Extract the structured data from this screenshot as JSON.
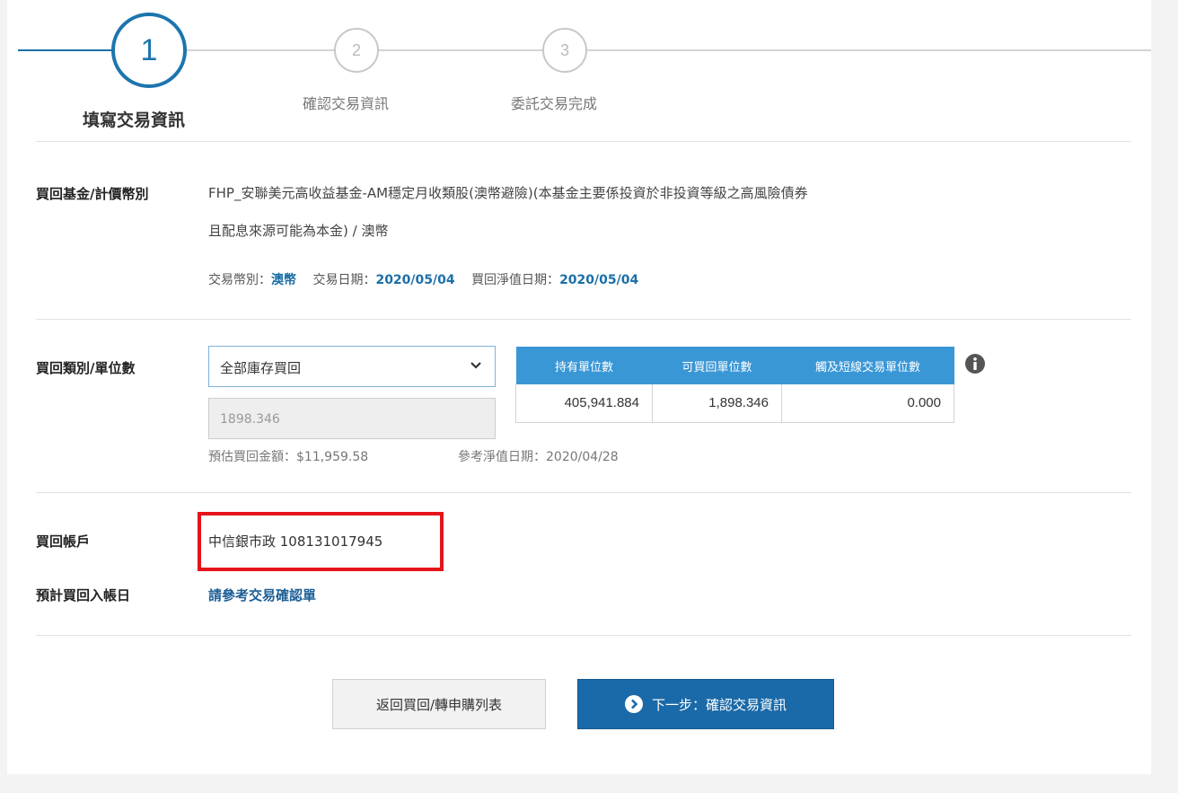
{
  "stepper": {
    "steps": [
      {
        "number": "1",
        "label": "填寫交易資訊",
        "state": "active"
      },
      {
        "number": "2",
        "label": "確認交易資訊",
        "state": "pending"
      },
      {
        "number": "3",
        "label": "委託交易完成",
        "state": "pending"
      }
    ]
  },
  "fund": {
    "label": "買回基金/計價幣別",
    "name_line1": "FHP_安聯美元高收益基金-AM穩定月收類股(澳幣避險)(本基金主要係投資於非投資等級之高風險債券",
    "name_line2": "且配息來源可能為本金) / 澳幣",
    "currency_label": "交易幣別：",
    "currency_value": "澳幣",
    "trade_date_label": "交易日期：",
    "trade_date_value": "2020/05/04",
    "nav_date_label": "買回淨值日期：",
    "nav_date_value": "2020/05/04"
  },
  "redeem": {
    "label": "買回類別/單位數",
    "type_selected": "全部庫存買回",
    "units_value": "1898.346",
    "estimate_text": "預估買回金額：$11,959.58",
    "ref_nav_text": "參考淨值日期：2020/04/28",
    "table": {
      "headers": [
        "持有單位數",
        "可買回單位數",
        "觸及短線交易單位數"
      ],
      "row": [
        "405,941.884",
        "1,898.346",
        "0.000"
      ]
    }
  },
  "account": {
    "label": "買回帳戶",
    "value": "中信銀市政 108131017945",
    "date_label": "預計買回入帳日",
    "date_link": "請參考交易確認單"
  },
  "buttons": {
    "back": "返回買回/轉申購列表",
    "next": "下一步：確認交易資訊"
  },
  "colors": {
    "primary": "#1c6fa8",
    "table_header": "#3a97d6",
    "highlight": "#e5141b"
  }
}
